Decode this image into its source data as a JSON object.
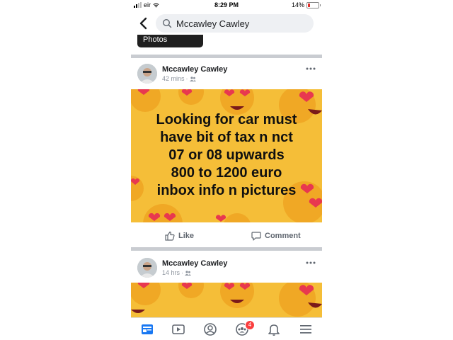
{
  "status_bar": {
    "carrier": "eir",
    "time": "8:29 PM",
    "battery": "14%"
  },
  "search": {
    "query": "Mccawley Cawley"
  },
  "photos_label": "Photos",
  "posts": [
    {
      "author": "Mccawley Cawley",
      "time": "42 mins",
      "text_lines": [
        "Looking for car must",
        "have bit of tax n nct",
        "07 or 08 upwards",
        "800 to 1200 euro",
        "inbox info n pictures"
      ],
      "actions": {
        "like": "Like",
        "comment": "Comment"
      }
    },
    {
      "author": "Mccawley Cawley",
      "time": "14 hrs"
    }
  ],
  "nav": {
    "notifications_badge": "4"
  },
  "colors": {
    "accent": "#1877f2",
    "post_bg": "#f5be38",
    "badge": "#fa3e3e"
  }
}
